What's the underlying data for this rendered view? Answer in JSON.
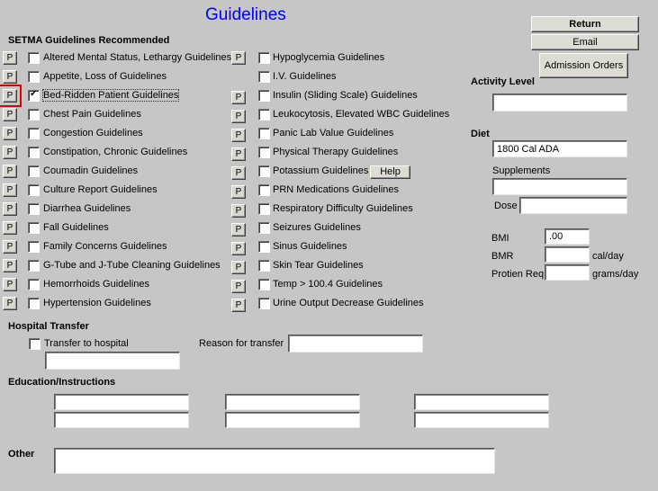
{
  "page": {
    "title": "Guidelines"
  },
  "guidelines": {
    "heading": "SETMA Guidelines Recommended",
    "p_label": "P",
    "left": [
      {
        "label": "Altered Mental Status, Lethargy Guidelines",
        "checked": false,
        "has_p": true
      },
      {
        "label": "Appetite, Loss of Guidelines",
        "checked": false,
        "has_p": true
      },
      {
        "label": "Bed-Ridden Patient Guidelines",
        "checked": true,
        "has_p": true,
        "highlighted": true
      },
      {
        "label": "Chest Pain Guidelines",
        "checked": false,
        "has_p": true
      },
      {
        "label": "Congestion Guidelines",
        "checked": false,
        "has_p": true
      },
      {
        "label": "Constipation, Chronic Guidelines",
        "checked": false,
        "has_p": true
      },
      {
        "label": "Coumadin Guidelines",
        "checked": false,
        "has_p": true
      },
      {
        "label": "Culture Report Guidelines",
        "checked": false,
        "has_p": true
      },
      {
        "label": "Diarrhea Guidelines",
        "checked": false,
        "has_p": true
      },
      {
        "label": "Fall Guidelines",
        "checked": false,
        "has_p": true
      },
      {
        "label": "Family Concerns Guidelines",
        "checked": false,
        "has_p": true
      },
      {
        "label": "G-Tube and J-Tube Cleaning Guidelines",
        "checked": false,
        "has_p": true
      },
      {
        "label": "Hemorrhoids Guidelines",
        "checked": false,
        "has_p": true
      },
      {
        "label": "Hypertension Guidelines",
        "checked": false,
        "has_p": true
      }
    ],
    "right": [
      {
        "label": "Hypoglycemia Guidelines",
        "checked": false,
        "has_p": true
      },
      {
        "label": "I.V. Guidelines",
        "checked": false,
        "has_p": false
      },
      {
        "label": "Insulin (Sliding Scale) Guidelines",
        "checked": false,
        "has_p": true
      },
      {
        "label": "Leukocytosis, Elevated WBC Guidelines",
        "checked": false,
        "has_p": true
      },
      {
        "label": "Panic Lab Value Guidelines",
        "checked": false,
        "has_p": true
      },
      {
        "label": "Physical Therapy Guidelines",
        "checked": false,
        "has_p": true
      },
      {
        "label": "Potassium Guidelines",
        "checked": false,
        "has_p": true
      },
      {
        "label": "PRN Medications Guidelines",
        "checked": false,
        "has_p": true
      },
      {
        "label": "Respiratory Difficulty Guidelines",
        "checked": false,
        "has_p": true
      },
      {
        "label": "Seizures Guidelines",
        "checked": false,
        "has_p": true
      },
      {
        "label": "Sinus Guidelines",
        "checked": false,
        "has_p": true
      },
      {
        "label": "Skin Tear Guidelines",
        "checked": false,
        "has_p": true
      },
      {
        "label": "Temp > 100.4 Guidelines",
        "checked": false,
        "has_p": true
      },
      {
        "label": "Urine Output Decrease Guidelines",
        "checked": false,
        "has_p": true
      }
    ],
    "help_label": "Help"
  },
  "actions": {
    "return_label": "Return",
    "email_label": "Email",
    "admission_orders_label": "Admission Orders"
  },
  "activity": {
    "label": "Activity Level",
    "value": ""
  },
  "diet": {
    "label": "Diet",
    "value": "1800 Cal ADA",
    "supplements_label": "Supplements",
    "supplements_value": "",
    "dose_label": "Dose",
    "dose_value": ""
  },
  "metrics": {
    "bmi_label": "BMI",
    "bmi_value": ".00",
    "bmr_label": "BMR",
    "bmr_value": "",
    "bmr_unit": "cal/day",
    "protein_label": "Protien Req",
    "protein_value": "",
    "protein_unit": "grams/day"
  },
  "transfer": {
    "heading": "Hospital Transfer",
    "checkbox_label": "Transfer to hospital",
    "checked": false,
    "hospital_value": "",
    "reason_label": "Reason for transfer",
    "reason_value": ""
  },
  "education": {
    "heading": "Education/Instructions",
    "fields": [
      "",
      "",
      "",
      "",
      "",
      ""
    ]
  },
  "other": {
    "label": "Other",
    "value": ""
  }
}
